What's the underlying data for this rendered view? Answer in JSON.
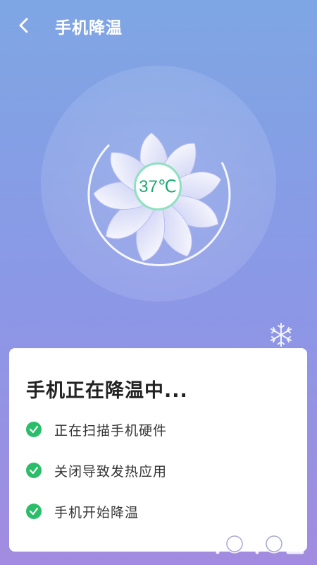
{
  "header": {
    "title": "手机降温",
    "back_icon": "back-chevron-icon"
  },
  "cooling": {
    "temperature": "37℃",
    "fan_icon": "fan-icon",
    "snow_icon": "snowflake-icon"
  },
  "status_card": {
    "title": "手机正在降温中...",
    "steps": [
      {
        "label": "正在扫描手机硬件",
        "icon": "check-circle-icon"
      },
      {
        "label": "关闭导致发热应用",
        "icon": "check-circle-icon"
      },
      {
        "label": "手机开始降温",
        "icon": "check-circle-icon"
      }
    ]
  },
  "colors": {
    "accent_green": "#2bbd6a",
    "temp_text": "#1ea971",
    "background_top": "#7ea6e4",
    "background_bottom": "#a28be0"
  }
}
